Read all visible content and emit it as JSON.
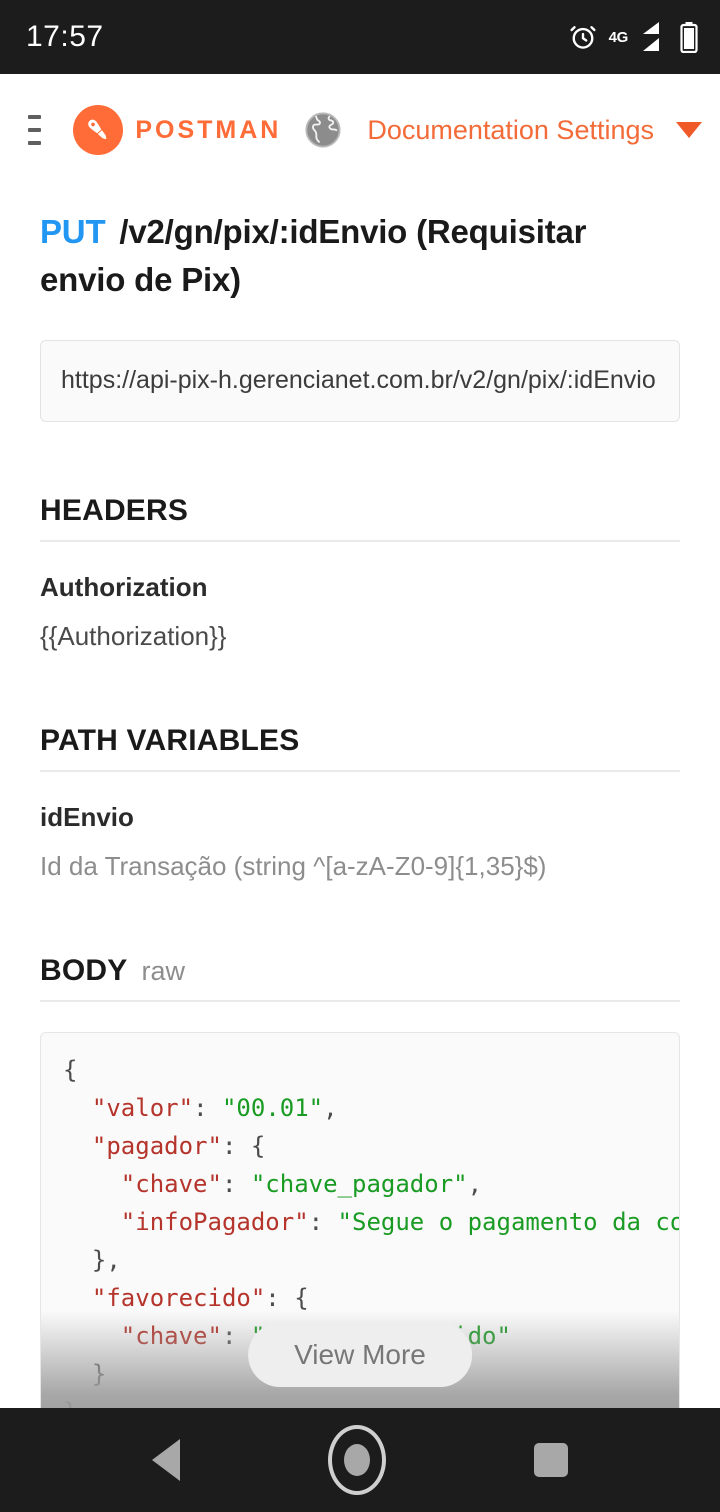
{
  "statusbar": {
    "time": "17:57",
    "network": "4G",
    "icons": [
      "alarm-icon",
      "signal-icon",
      "battery-icon"
    ]
  },
  "header": {
    "menu_icon": "hamburger-icon",
    "logo_icon": "postman-logo-icon",
    "brand": "POSTMAN",
    "globe_icon": "globe-icon",
    "settings_label": "Documentation Settings",
    "caret_icon": "chevron-down-icon",
    "accent_color": "#FF6C37"
  },
  "endpoint": {
    "method": "PUT",
    "method_color": "#2196F3",
    "path": "/v2/gn/pix/:idEnvio (Requisitar envio de Pix)",
    "url": "https://api-pix-h.gerencianet.com.br/v2/gn/pix/:idEnvio"
  },
  "sections": {
    "headers": {
      "title": "HEADERS",
      "key": "Authorization",
      "value": "{{Authorization}}"
    },
    "path_variables": {
      "title": "PATH VARIABLES",
      "key": "idEnvio",
      "value": "Id da Transação (string ^[a-zA-Z0-9]{1,35}$)"
    },
    "body": {
      "title": "BODY",
      "subtitle": "raw",
      "view_more_label": "View More",
      "lines": [
        {
          "indent": 0,
          "parts": [
            {
              "t": "{",
              "c": "pun"
            }
          ]
        },
        {
          "indent": 1,
          "parts": [
            {
              "t": "\"valor\"",
              "c": "key"
            },
            {
              "t": ": ",
              "c": "pun"
            },
            {
              "t": "\"00.01\"",
              "c": "str"
            },
            {
              "t": ",",
              "c": "pun"
            }
          ]
        },
        {
          "indent": 1,
          "parts": [
            {
              "t": "\"pagador\"",
              "c": "key"
            },
            {
              "t": ": {",
              "c": "pun"
            }
          ]
        },
        {
          "indent": 2,
          "parts": [
            {
              "t": "\"chave\"",
              "c": "key"
            },
            {
              "t": ": ",
              "c": "pun"
            },
            {
              "t": "\"chave_pagador\"",
              "c": "str"
            },
            {
              "t": ",",
              "c": "pun"
            }
          ]
        },
        {
          "indent": 2,
          "parts": [
            {
              "t": "\"infoPagador\"",
              "c": "key"
            },
            {
              "t": ": ",
              "c": "pun"
            },
            {
              "t": "\"Segue o pagamento da co",
              "c": "str"
            }
          ]
        },
        {
          "indent": 1,
          "parts": [
            {
              "t": "},",
              "c": "pun"
            }
          ]
        },
        {
          "indent": 1,
          "parts": [
            {
              "t": "\"favorecido\"",
              "c": "key"
            },
            {
              "t": ": {",
              "c": "pun"
            }
          ]
        },
        {
          "indent": 2,
          "parts": [
            {
              "t": "\"chave\"",
              "c": "key"
            },
            {
              "t": ": ",
              "c": "pun"
            },
            {
              "t": "\"chave_favorecido\"",
              "c": "str"
            }
          ]
        },
        {
          "indent": 1,
          "parts": [
            {
              "t": "}",
              "c": "pun"
            }
          ]
        },
        {
          "indent": 0,
          "parts": [
            {
              "t": "}",
              "c": "pun"
            }
          ]
        }
      ]
    }
  },
  "navbar": {
    "back": "back-icon",
    "home": "home-icon",
    "recents": "recents-icon"
  }
}
